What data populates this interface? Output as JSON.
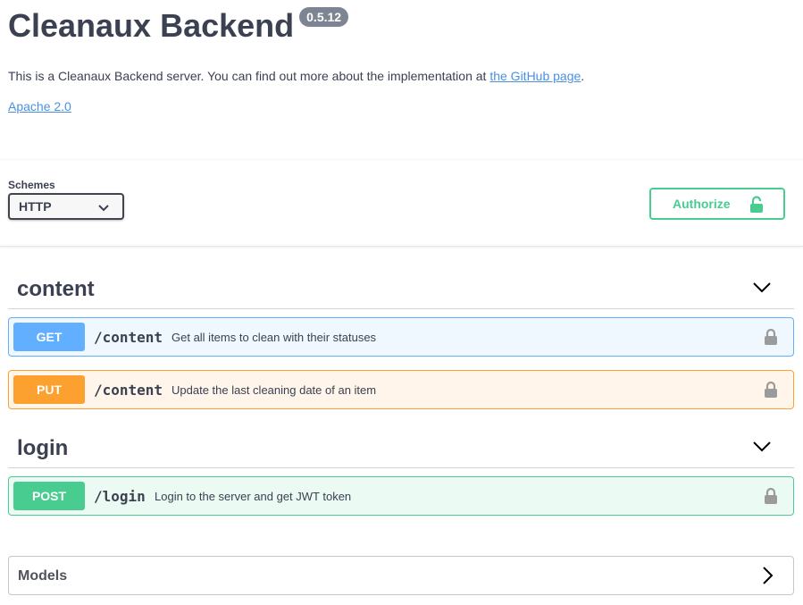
{
  "info": {
    "title": "Cleanaux Backend",
    "version": "0.5.12",
    "description_prefix": "This is a Cleanaux Backend server. You can find out more about the implementation at ",
    "description_link": "the GitHub page",
    "description_suffix": ".",
    "license": "Apache 2.0"
  },
  "schemes": {
    "label": "Schemes",
    "selected": "HTTP"
  },
  "authorize": {
    "label": "Authorize",
    "icon": "unlock-icon"
  },
  "tags": [
    {
      "name": "content",
      "operations": [
        {
          "method": "GET",
          "path": "/content",
          "summary": "Get all items to clean with their statuses"
        },
        {
          "method": "PUT",
          "path": "/content",
          "summary": "Update the last cleaning date of an item"
        }
      ]
    },
    {
      "name": "login",
      "operations": [
        {
          "method": "POST",
          "path": "/login",
          "summary": "Login to the server and get JWT token"
        }
      ]
    }
  ],
  "models": {
    "label": "Models"
  },
  "colors": {
    "get": "#61affe",
    "put": "#fca130",
    "post": "#49cc90",
    "link": "#4990e2"
  }
}
